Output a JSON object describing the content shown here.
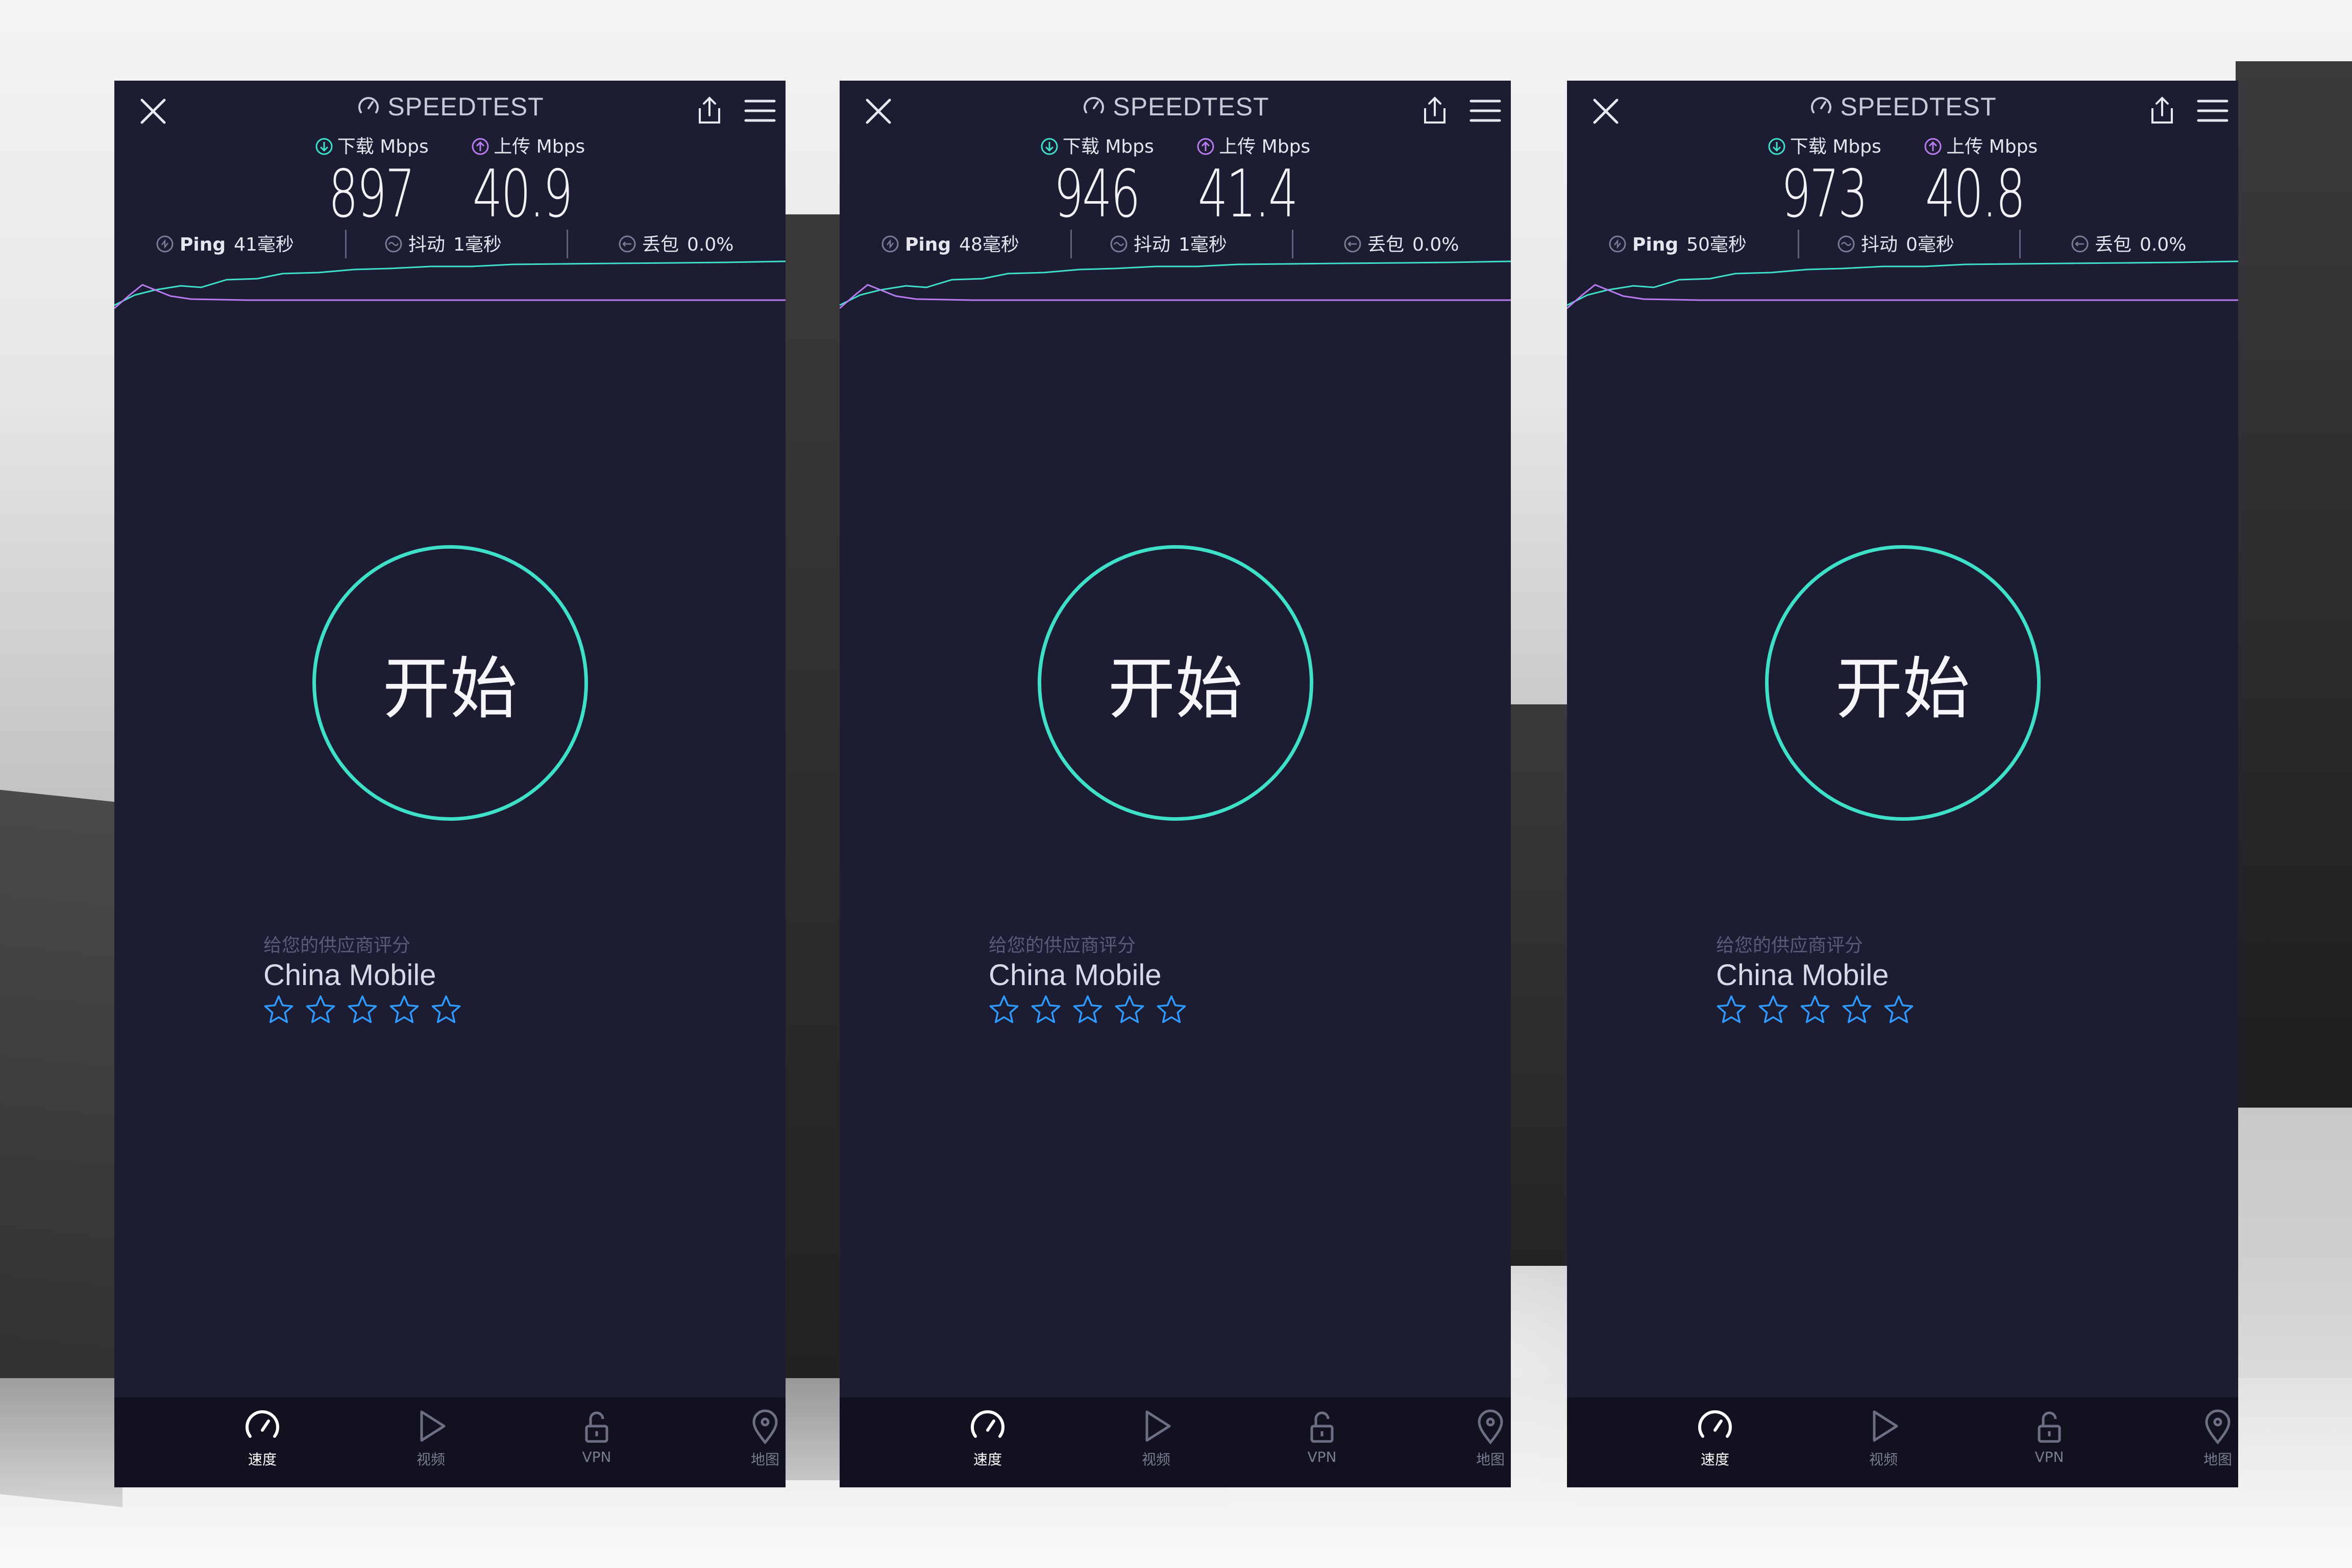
{
  "colors": {
    "background": "#1c1c33",
    "nav_background": "#11111f",
    "accent_teal": "#3ee0c8",
    "accent_purple": "#b87cf0",
    "star_blue": "#2f9bff"
  },
  "screens": [
    {
      "brand": "SPEEDTEST",
      "download_label": "下载 Mbps",
      "upload_label": "上传 Mbps",
      "download_value": "897",
      "upload_value": "40.9",
      "ping_label": "Ping",
      "ping_value": "41毫秒",
      "jitter_label": "抖动",
      "jitter_value": "1毫秒",
      "loss_label": "丢包",
      "loss_value": "0.0%",
      "start_label": "开始",
      "rate_prompt": "给您的供应商评分",
      "provider": "China Mobile",
      "stars": 5,
      "nav": [
        {
          "label": "速度",
          "icon": "speedometer-icon",
          "active": true
        },
        {
          "label": "视频",
          "icon": "play-icon",
          "active": false
        },
        {
          "label": "VPN",
          "icon": "lock-icon",
          "active": false
        },
        {
          "label": "地图",
          "icon": "map-pin-icon",
          "active": false
        }
      ]
    },
    {
      "brand": "SPEEDTEST",
      "download_label": "下载 Mbps",
      "upload_label": "上传 Mbps",
      "download_value": "946",
      "upload_value": "41.4",
      "ping_label": "Ping",
      "ping_value": "48毫秒",
      "jitter_label": "抖动",
      "jitter_value": "1毫秒",
      "loss_label": "丢包",
      "loss_value": "0.0%",
      "start_label": "开始",
      "rate_prompt": "给您的供应商评分",
      "provider": "China Mobile",
      "stars": 5,
      "nav": [
        {
          "label": "速度",
          "icon": "speedometer-icon",
          "active": true
        },
        {
          "label": "视频",
          "icon": "play-icon",
          "active": false
        },
        {
          "label": "VPN",
          "icon": "lock-icon",
          "active": false
        },
        {
          "label": "地图",
          "icon": "map-pin-icon",
          "active": false
        }
      ]
    },
    {
      "brand": "SPEEDTEST",
      "download_label": "下载 Mbps",
      "upload_label": "上传 Mbps",
      "download_value": "973",
      "upload_value": "40.8",
      "ping_label": "Ping",
      "ping_value": "50毫秒",
      "jitter_label": "抖动",
      "jitter_value": "0毫秒",
      "loss_label": "丢包",
      "loss_value": "0.0%",
      "start_label": "开始",
      "rate_prompt": "给您的供应商评分",
      "provider": "China Mobile",
      "stars": 5,
      "nav": [
        {
          "label": "速度",
          "icon": "speedometer-icon",
          "active": true
        },
        {
          "label": "视频",
          "icon": "play-icon",
          "active": false
        },
        {
          "label": "VPN",
          "icon": "lock-icon",
          "active": false
        },
        {
          "label": "地图",
          "icon": "map-pin-icon",
          "active": false
        }
      ]
    }
  ]
}
